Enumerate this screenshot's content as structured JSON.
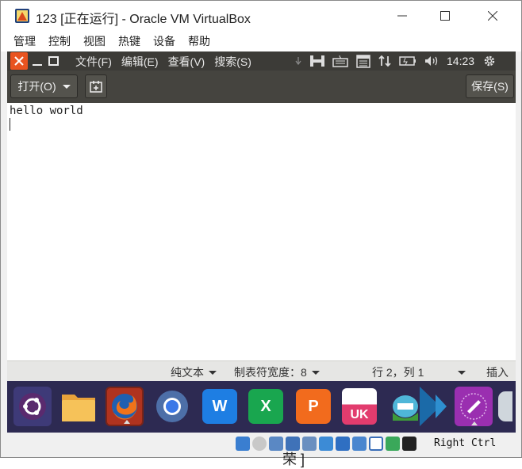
{
  "window": {
    "title": "123 [正在运行] - Oracle VM VirtualBox",
    "controls": {
      "minimize": "—",
      "maximize": "☐",
      "close": "✕"
    }
  },
  "host_menu": [
    "管理",
    "控制",
    "视图",
    "热键",
    "设备",
    "帮助"
  ],
  "guest_panel": {
    "menus": [
      "文件(F)",
      "编辑(E)",
      "查看(V)",
      "搜索(S)"
    ],
    "clock": "14:23"
  },
  "editor": {
    "open_label": "打开(O)",
    "save_label": "保存(S)",
    "text_line": "hello world"
  },
  "statusbar": {
    "syntax": "纯文本",
    "tab_width": "制表符宽度：8",
    "position": "行 2，列 1",
    "mode": "插入"
  },
  "dock": {
    "icons": [
      "ubuntu-icon",
      "files-icon",
      "firefox-icon",
      "chromium-icon",
      "wps-writer-icon",
      "wps-spreadsheet-icon",
      "wps-presentation-icon",
      "software-center-icon",
      "installer-icon",
      "kylin-arrow-icon",
      "text-editor-icon",
      "partial-icon"
    ],
    "wps_writer_letter": "W",
    "wps_spreadsheet_letter": "X",
    "wps_presentation_letter": "P",
    "software_center_label": "UK"
  },
  "host_status": {
    "host_key": "Right Ctrl"
  },
  "background_fragment": "荣 ]"
}
